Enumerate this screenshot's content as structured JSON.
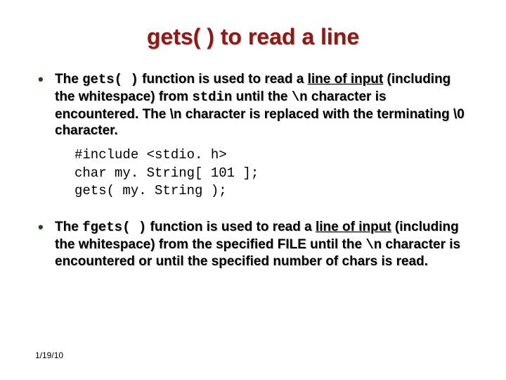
{
  "title": "gets( ) to read a line",
  "bullet1": {
    "t1": "The ",
    "m1": "gets( )",
    "t2": " function is used to read a ",
    "u1": "line of input",
    "t3": " (including the whitespace) from ",
    "m2": "stdin",
    "t4": " until the ",
    "m3": "\\n",
    "t5": " character is encountered.  The \\n character is replaced with the terminating \\0 character."
  },
  "code": "#include <stdio. h>\nchar my. String[ 101 ];\ngets( my. String );",
  "bullet2": {
    "t1": "The ",
    "m1": "fgets( )",
    "t2": " function is used to read a ",
    "u1": "line of input",
    "t3": " (including the whitespace) from the specified FILE until the ",
    "m2": "\\n",
    "t4": " character is encountered or until the specified number of chars is read."
  },
  "date": "1/19/10"
}
